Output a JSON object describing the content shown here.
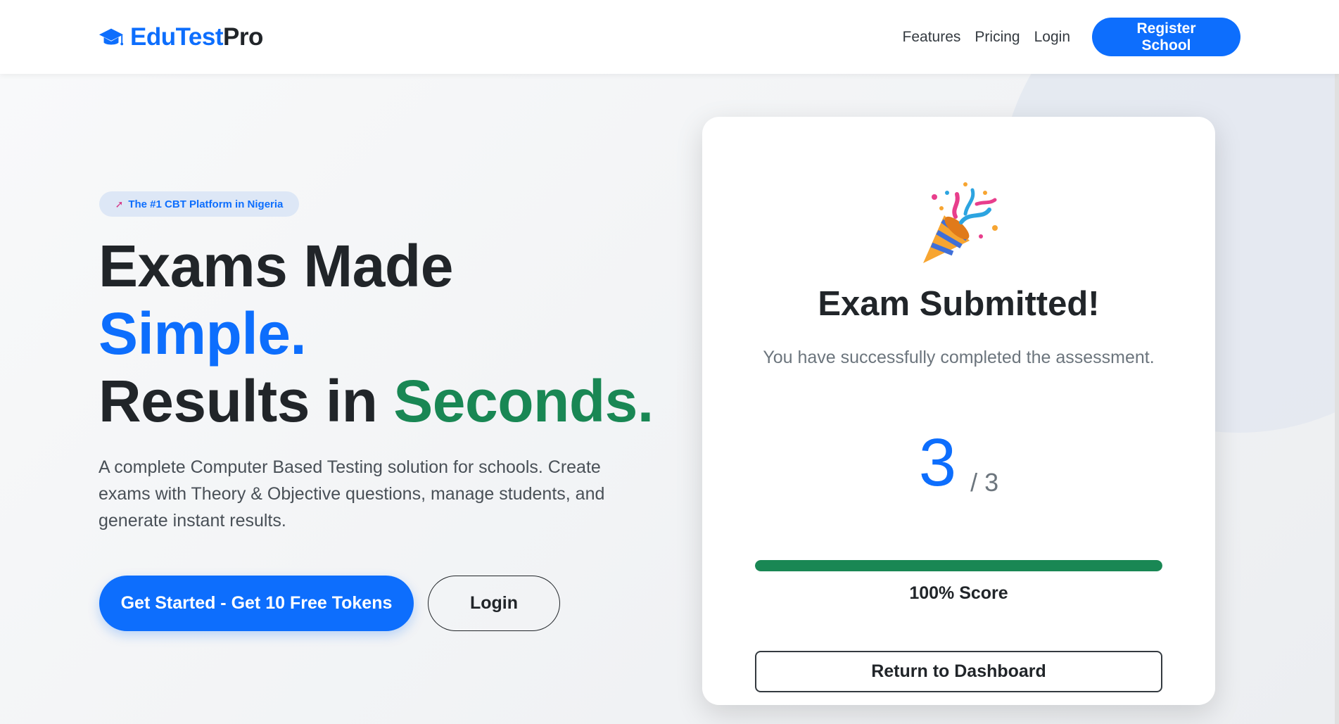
{
  "navbar": {
    "brand_part1": "EduTest",
    "brand_part2": "Pro",
    "brand_icon": "graduation-cap-icon",
    "links": [
      "Features",
      "Pricing",
      "Login"
    ],
    "register_label": "Register School"
  },
  "hero": {
    "badge_icon": "rocket-icon",
    "badge_text": "The #1 CBT Platform in Nigeria",
    "headline_line1": "Exams Made",
    "headline_line2": "Simple.",
    "headline_line3a": "Results in ",
    "headline_line3b": "Seconds.",
    "lead": "A complete Computer Based Testing solution for schools. Create exams with Theory & Objective questions, manage students, and generate instant results.",
    "cta_primary": "Get Started - Get 10 Free Tokens",
    "cta_secondary": "Login"
  },
  "result_card": {
    "icon": "party-popper-icon",
    "title": "Exam Submitted!",
    "subtitle": "You have successfully completed the assessment.",
    "score": "3",
    "total": "/ 3",
    "progress_fraction": 1.0,
    "percent_label": "100% Score",
    "dashboard_button": "Return to Dashboard"
  },
  "colors": {
    "primary": "#0d6efd",
    "success": "#198754",
    "dark": "#212529",
    "muted": "#6c757d"
  }
}
